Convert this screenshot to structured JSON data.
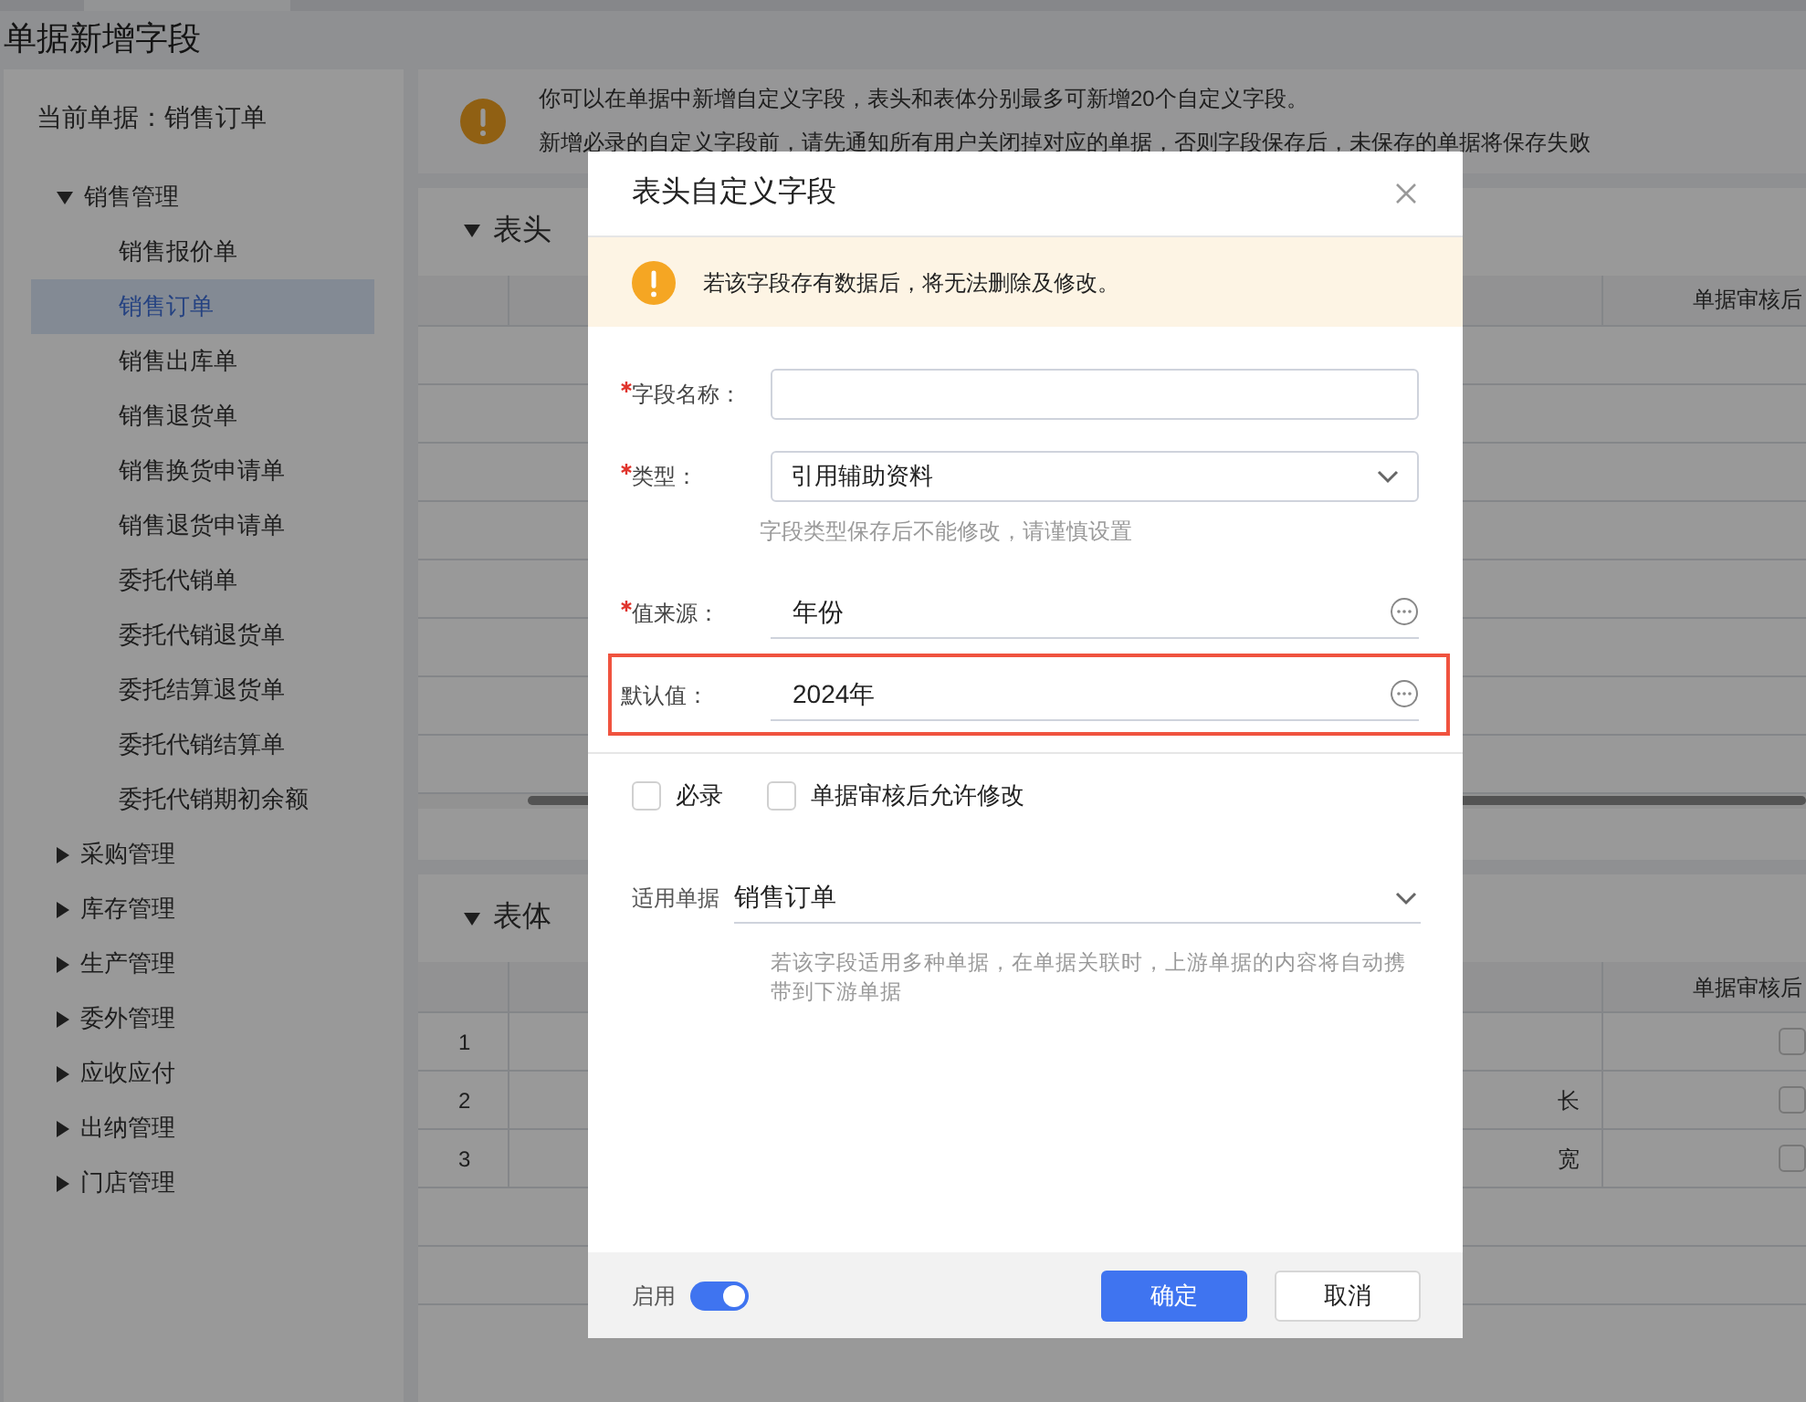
{
  "page": {
    "title": "单据新增字段"
  },
  "sidebar": {
    "current_label": "当前单据：销售订单",
    "groups": [
      {
        "label": "销售管理",
        "expanded": true,
        "children": [
          {
            "label": "销售报价单",
            "selected": false
          },
          {
            "label": "销售订单",
            "selected": true
          },
          {
            "label": "销售出库单",
            "selected": false
          },
          {
            "label": "销售退货单",
            "selected": false
          },
          {
            "label": "销售换货申请单",
            "selected": false
          },
          {
            "label": "销售退货申请单",
            "selected": false
          },
          {
            "label": "委托代销单",
            "selected": false
          },
          {
            "label": "委托代销退货单",
            "selected": false
          },
          {
            "label": "委托结算退货单",
            "selected": false
          },
          {
            "label": "委托代销结算单",
            "selected": false
          },
          {
            "label": "委托代销期初余额",
            "selected": false
          }
        ]
      },
      {
        "label": "采购管理",
        "expanded": false
      },
      {
        "label": "库存管理",
        "expanded": false
      },
      {
        "label": "生产管理",
        "expanded": false
      },
      {
        "label": "委外管理",
        "expanded": false
      },
      {
        "label": "应收应付",
        "expanded": false
      },
      {
        "label": "出纳管理",
        "expanded": false
      },
      {
        "label": "门店管理",
        "expanded": false
      }
    ]
  },
  "notice": {
    "lines": [
      "你可以在单据中新增自定义字段，表头和表体分别最多可新增20个自定义字段。",
      "新增必录的自定义字段前，请先通知所有用户关闭掉对应的单据，否则字段保存后，未保存的单据将保存失败"
    ]
  },
  "header_section": {
    "title": "表头",
    "expanded": true,
    "columns": [
      "单据审核后"
    ]
  },
  "body_section": {
    "title": "表体",
    "expanded": true,
    "columns": [
      "单据审核后"
    ],
    "rows": [
      {
        "number": "1",
        "checked": false
      },
      {
        "number": "2",
        "column_2": "长",
        "checked": false
      },
      {
        "number": "3",
        "column_2": "宽",
        "checked": false
      }
    ]
  },
  "dialog": {
    "title": "表头自定义字段",
    "warning": "若该字段存有数据后，将无法删除及修改。",
    "fields": [
      {
        "kind": "text",
        "label": "字段名称：",
        "required": true,
        "highlighted": false
      },
      {
        "kind": "select",
        "label": "类型：",
        "required": true,
        "value": "引用辅助资料",
        "hint": "字段类型保存后不能修改，请谨慎设置",
        "highlighted": false
      },
      {
        "kind": "lookup",
        "label": "值来源：",
        "required": true,
        "value": "年份",
        "highlighted": false
      },
      {
        "kind": "lookup",
        "label": "默认值：",
        "required": false,
        "value": "2024年",
        "highlighted": true
      }
    ],
    "options": [
      {
        "label": "必录",
        "checked": false
      },
      {
        "label": "单据审核后允许修改",
        "checked": false
      }
    ],
    "applies_to": {
      "label": "适用单据",
      "value": "销售订单",
      "hint": "若该字段适用多种单据，在单据关联时，上游单据的内容将自动携带到下游单据"
    },
    "enabled": {
      "label": "启用",
      "on": true
    },
    "buttons": [
      {
        "label": "确定",
        "primary": true
      },
      {
        "label": "取消",
        "primary": false
      }
    ]
  }
}
